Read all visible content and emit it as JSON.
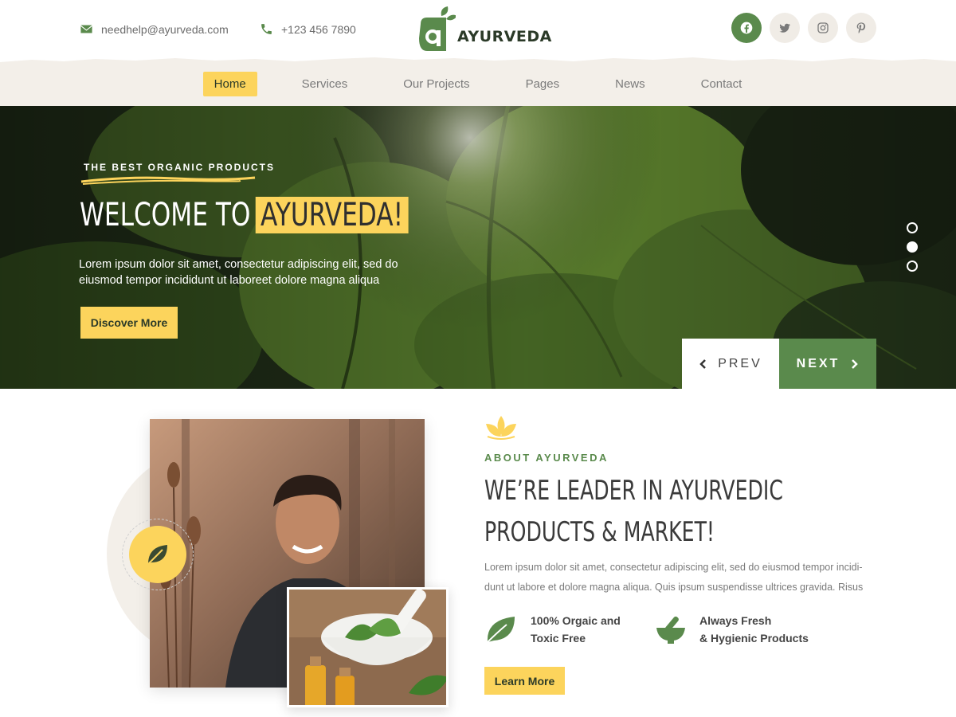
{
  "header": {
    "email": "needhelp@ayurveda.com",
    "phone": "+123 456 7890",
    "brand": "AYURVEDA",
    "socials": [
      "facebook-icon",
      "twitter-icon",
      "instagram-icon",
      "pinterest-icon"
    ]
  },
  "nav": {
    "items": [
      "Home",
      "Services",
      "Our Projects",
      "Pages",
      "News",
      "Contact"
    ],
    "active": "Home"
  },
  "hero": {
    "tagline": "THE BEST ORGANIC PRODUCTS",
    "title_prefix": "WELCOME TO",
    "title_highlight": "AYURVEDA!",
    "description": "Lorem ipsum dolor sit amet, consectetur adipiscing elit, sed do eiusmod  tempor incididunt ut laboreet dolore magna aliqua",
    "cta": "Discover More",
    "prev": "PREV",
    "next": "NEXT",
    "slides": 3,
    "active_slide": 2
  },
  "about": {
    "tag": "ABOUT AYURVEDA",
    "title_line1": "WE’RE LEADER IN AYURVEDIC",
    "title_line2": "PRODUCTS & MARKET!",
    "description": "Lorem ipsum dolor sit amet, consectetur adipiscing elit, sed do eiusmod tempor incidi- dunt ut labore et dolore magna aliqua. Quis ipsum suspendisse ultrices gravida. Risus",
    "feature1_line1": "100% Orgaic and",
    "feature1_line2": "Toxic Free",
    "feature2_line1": "Always Fresh",
    "feature2_line2": "& Hygienic Products",
    "cta": "Learn More"
  },
  "colors": {
    "primary_green": "#5a8a4c",
    "accent_yellow": "#fcd45c",
    "nav_bg": "#f3efe9",
    "dark_text": "#2b3a28"
  }
}
